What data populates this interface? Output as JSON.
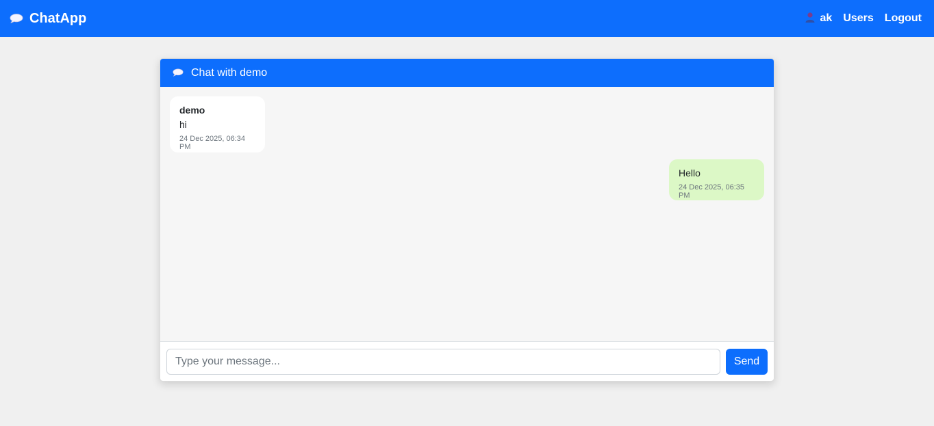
{
  "navbar": {
    "brand": "ChatApp",
    "brand_icon": "speech-bubble-icon",
    "user_icon": "user-icon",
    "username": "ak",
    "links": [
      "Users",
      "Logout"
    ]
  },
  "chat": {
    "title": "Chat with demo",
    "title_icon": "speech-bubble-icon",
    "messages": [
      {
        "direction": "incoming",
        "sender": "demo",
        "text": "hi",
        "time": "24 Dec 2025, 06:34 PM"
      },
      {
        "direction": "outgoing",
        "text": "Hello",
        "time": "24 Dec 2025, 06:35 PM"
      }
    ],
    "input_placeholder": "Type your message...",
    "input_value": "",
    "send_label": "Send"
  },
  "colors": {
    "primary": "#0d6efd",
    "incoming_bubble": "#ffffff",
    "outgoing_bubble": "#dcf8c6",
    "page_bg": "#f0f0f0"
  }
}
